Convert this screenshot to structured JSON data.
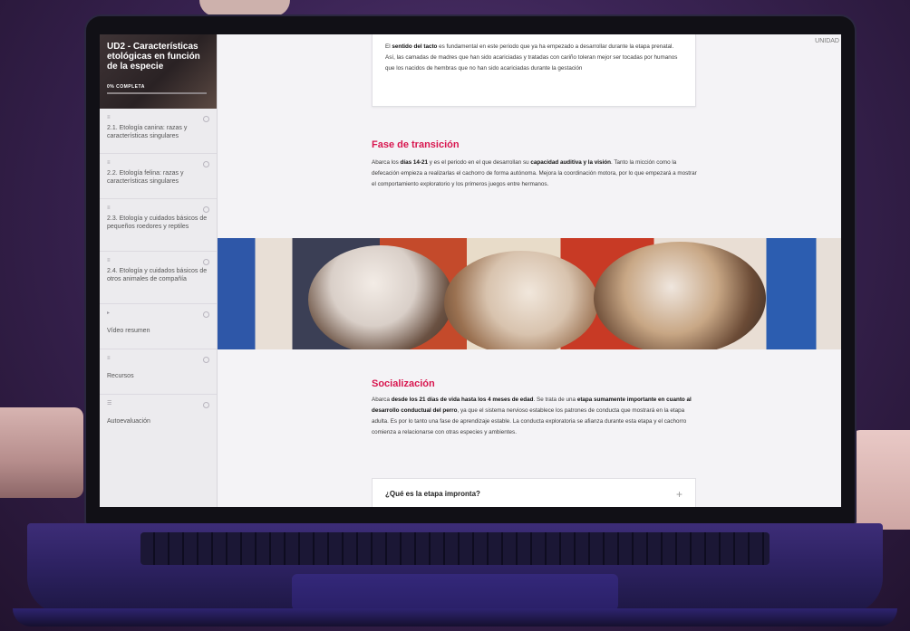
{
  "sidebar": {
    "course_title": "UD2 - Características etológicas en función de la especie",
    "progress_label": "0% COMPLETA",
    "progress": 0,
    "items": [
      {
        "label": "2.1. Etología canina: razas y características singulares"
      },
      {
        "label": "2.2. Etología felina: razas y características singulares"
      },
      {
        "label": "2.3. Etología y cuidados básicos de pequeños roedores y reptiles"
      },
      {
        "label": "2.4. Etología y cuidados básicos de otros animales de compañía"
      },
      {
        "label": "Vídeo resumen"
      },
      {
        "label": "Recursos"
      },
      {
        "label": "Autoevaluación"
      }
    ]
  },
  "main": {
    "unit_label": "UNIDAD",
    "intro": {
      "t1": "El ",
      "b1": "sentido del tacto",
      "t2": " es fundamental en este periodo que ya ha empezado a desarrollar durante la etapa prenatal. Así, las camadas de madres que han sido acariciadas y tratadas con cariño toleran mejor ser tocadas por humanos que los nacidos de hembras que no han sido acariciadas durante la gestación"
    },
    "transition": {
      "title": "Fase de transición",
      "t1": "Abarca los ",
      "b1": "días 14-21",
      "t2": " y es el periodo en el que desarrollan su ",
      "b2": "capacidad auditiva y la visión",
      "t3": ". Tanto la micción como la defecación empieza a realizarlas el cachorro de forma autónoma. Mejora la coordinación motora, por lo que empezará a mostrar el comportamiento exploratorio y los primeros juegos entre hermanos."
    },
    "socialization": {
      "title": "Socialización",
      "t1": "Abarca ",
      "b1": "desde los 21 días de vida hasta los 4 meses de edad",
      "t2": ". Se trata de una ",
      "b2": "etapa sumamente importante en cuanto al desarrollo conductual del perro",
      "t3": ", ya que el sistema nervioso establece los patrones de conducta que mostrará en la etapa adulta. Es por lo tanto una fase de aprendizaje estable. La conducta exploratoria se afianza durante esta etapa y el cachorro comienza a relacionarse con otras especies y ambientes."
    },
    "accordion": {
      "title": "¿Qué es la etapa impronta?",
      "icon": "+"
    }
  },
  "colors": {
    "accent": "#d8164f",
    "sidebar_bg": "#ecebee",
    "content_bg": "#f4f3f6"
  }
}
